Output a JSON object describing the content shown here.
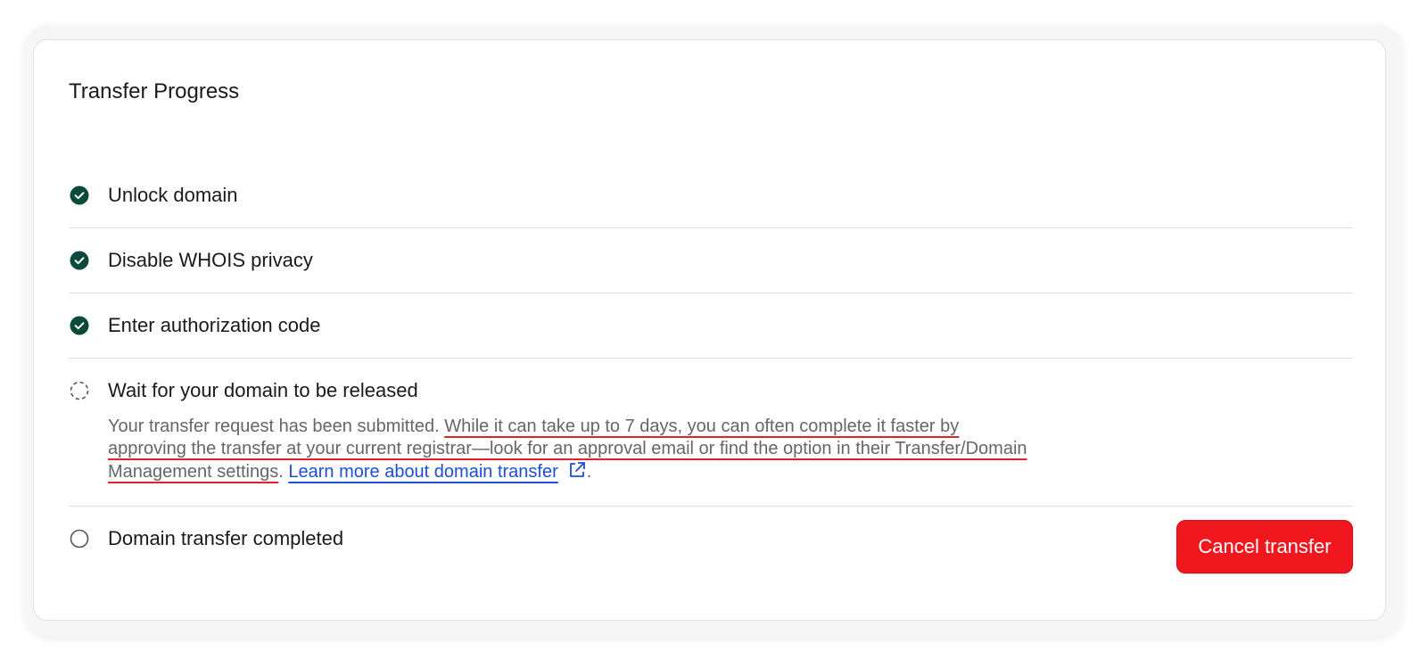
{
  "card": {
    "title": "Transfer Progress"
  },
  "steps": [
    {
      "label": "Unlock domain",
      "status": "complete",
      "icon": "check-circle-icon"
    },
    {
      "label": "Disable WHOIS privacy",
      "status": "complete",
      "icon": "check-circle-icon"
    },
    {
      "label": "Enter authorization code",
      "status": "complete",
      "icon": "check-circle-icon"
    },
    {
      "label": "Wait for your domain to be released",
      "status": "in-progress",
      "icon": "pending-dashed-circle-icon",
      "description": {
        "intro": "Your transfer request has been submitted.",
        "highlight": "While it can take up to 7 days, you can often complete it faster by approving the transfer at your current registrar—look for an approval email or find the option in their Transfer/Domain Management settings",
        "period": ".",
        "link_text": "Learn more about domain transfer",
        "end": "."
      }
    },
    {
      "label": "Domain transfer completed",
      "status": "pending",
      "icon": "empty-circle-icon"
    }
  ],
  "actions": {
    "cancel_label": "Cancel transfer"
  },
  "colors": {
    "complete": "#0b4a3a",
    "cancel": "#f0171f",
    "link": "#1d4ed8",
    "highlight_underline": "#e3202e"
  }
}
